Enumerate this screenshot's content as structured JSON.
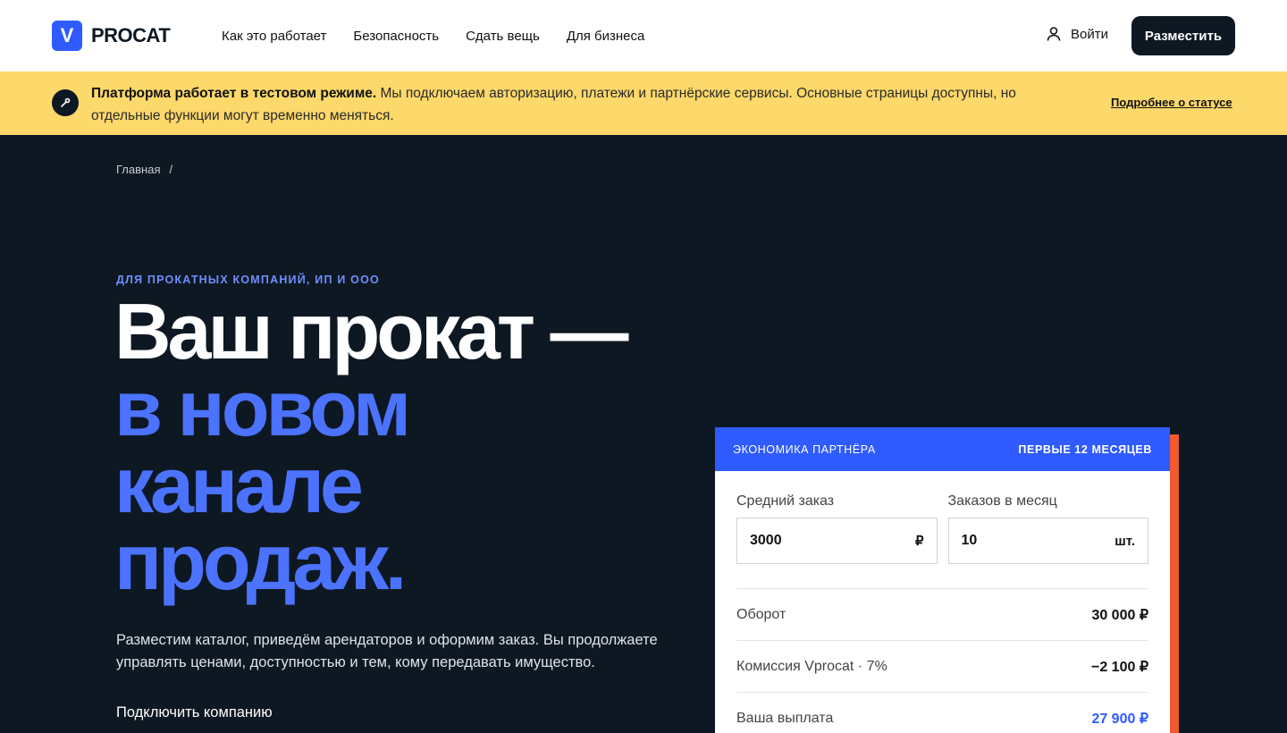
{
  "header": {
    "logo_mark": "V",
    "logo_text": "PROCAT",
    "nav": [
      "Как это работает",
      "Безопасность",
      "Сдать вещь",
      "Для бизнеса"
    ],
    "login_label": "Войти",
    "place_label": "Разместить"
  },
  "banner": {
    "bold": "Платформа работает в тестовом режиме.",
    "text": " Мы подключаем авторизацию, платежи и партнёрские сервисы. Основные страницы доступны, но отдельные функции могут временно меняться.",
    "link": "Подробнее о статусе"
  },
  "breadcrumb": {
    "home": "Главная",
    "sep": "/"
  },
  "hero": {
    "eyebrow": "ДЛЯ ПРОКАТНЫХ КОМПАНИЙ, ИП И ООО",
    "title_line1": "Ваш прокат —",
    "title_line2": "в новом",
    "title_line3": "канале",
    "title_line4": "продаж.",
    "subtitle": "Разместим каталог, приведём арендаторов и оформим заказ. Вы продолжаете управлять ценами, доступностью и тем, кому передавать имущество.",
    "cta": "Подключить компанию"
  },
  "calculator": {
    "head_left": "ЭКОНОМИКА ПАРТНЁРА",
    "head_right": "ПЕРВЫЕ 12 МЕСЯЦЕВ",
    "avg_order_label": "Средний заказ",
    "avg_order_value": "3000",
    "avg_order_unit": "₽",
    "orders_label": "Заказов в месяц",
    "orders_value": "10",
    "orders_unit": "шт.",
    "rows": [
      {
        "label": "Оборот",
        "value": "30 000 ₽"
      },
      {
        "label": "Комиссия Vprocat · 7%",
        "value": "−2 100 ₽"
      },
      {
        "label": "Ваша выплата",
        "value": "27 900 ₽"
      }
    ]
  },
  "colors": {
    "accent": "#2f5bff",
    "banner_bg": "#fdd86a",
    "page_bg": "#0e1822",
    "card_accent": "#ef5a2f"
  }
}
